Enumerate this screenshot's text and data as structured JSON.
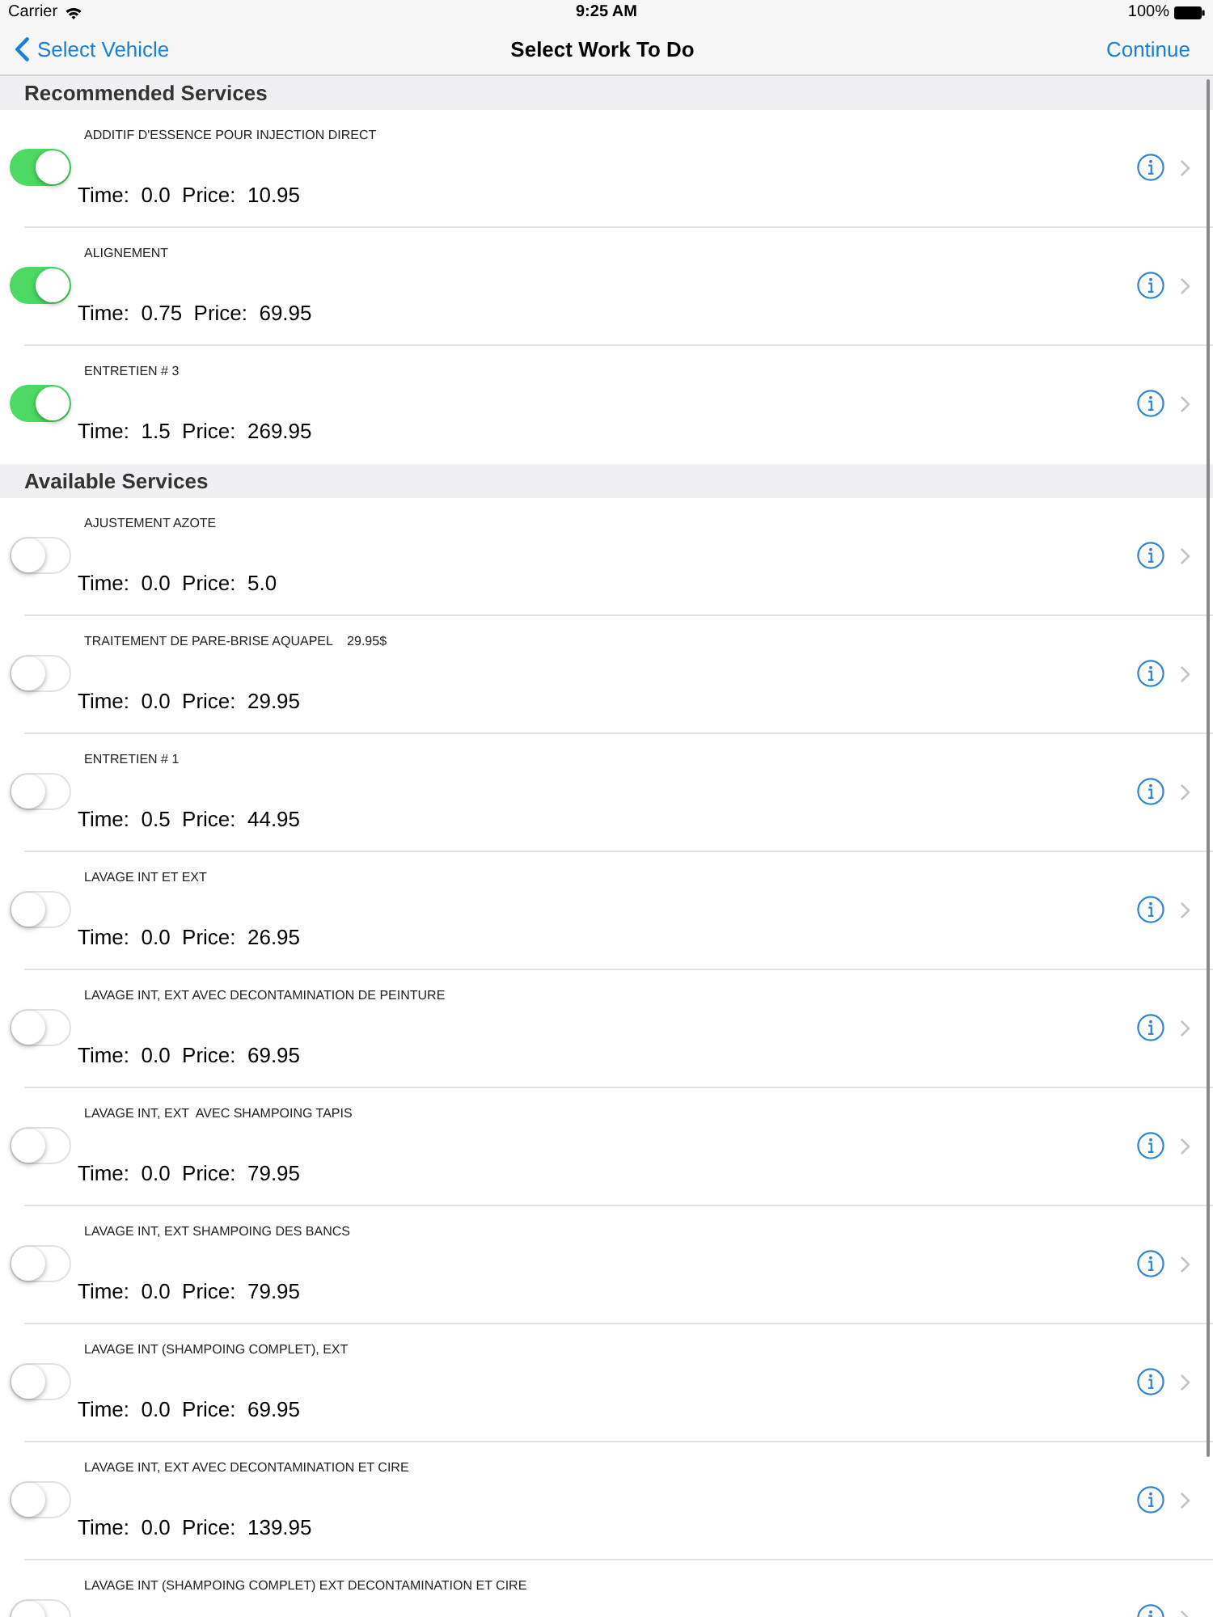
{
  "status_bar": {
    "carrier": "Carrier",
    "time": "9:25 AM",
    "battery": "100%"
  },
  "nav_bar": {
    "back": "Select Vehicle",
    "title": "Select Work To Do",
    "action": "Continue"
  },
  "sections": [
    {
      "title": "Recommended Services",
      "services": [
        {
          "name": "ADDITIF D'ESSENCE POUR INJECTION DIRECT",
          "detail": "Time:  0.0  Price:  10.95",
          "on": true
        },
        {
          "name": "ALIGNEMENT",
          "detail": "Time:  0.75  Price:  69.95",
          "on": true
        },
        {
          "name": "ENTRETIEN # 3",
          "detail": "Time:  1.5  Price:  269.95",
          "on": true
        }
      ]
    },
    {
      "title": "Available Services",
      "services": [
        {
          "name": "AJUSTEMENT AZOTE",
          "detail": "Time:  0.0  Price:  5.0",
          "on": false
        },
        {
          "name": "TRAITEMENT DE PARE-BRISE AQUAPEL    29.95$",
          "detail": "Time:  0.0  Price:  29.95",
          "on": false
        },
        {
          "name": "ENTRETIEN # 1",
          "detail": "Time:  0.5  Price:  44.95",
          "on": false
        },
        {
          "name": "LAVAGE INT ET EXT",
          "detail": "Time:  0.0  Price:  26.95",
          "on": false
        },
        {
          "name": "LAVAGE INT, EXT AVEC DECONTAMINATION DE PEINTURE",
          "detail": "Time:  0.0  Price:  69.95",
          "on": false
        },
        {
          "name": "LAVAGE INT, EXT  AVEC SHAMPOING TAPIS",
          "detail": "Time:  0.0  Price:  79.95",
          "on": false
        },
        {
          "name": "LAVAGE INT, EXT SHAMPOING DES BANCS",
          "detail": "Time:  0.0  Price:  79.95",
          "on": false
        },
        {
          "name": "LAVAGE INT (SHAMPOING COMPLET), EXT",
          "detail": "Time:  0.0  Price:  69.95",
          "on": false
        },
        {
          "name": "LAVAGE INT, EXT AVEC DECONTAMINATION ET CIRE",
          "detail": "Time:  0.0  Price:  139.95",
          "on": false
        },
        {
          "name": "LAVAGE INT (SHAMPOING COMPLET) EXT DECONTAMINATION ET CIRE",
          "on": false
        }
      ]
    }
  ]
}
